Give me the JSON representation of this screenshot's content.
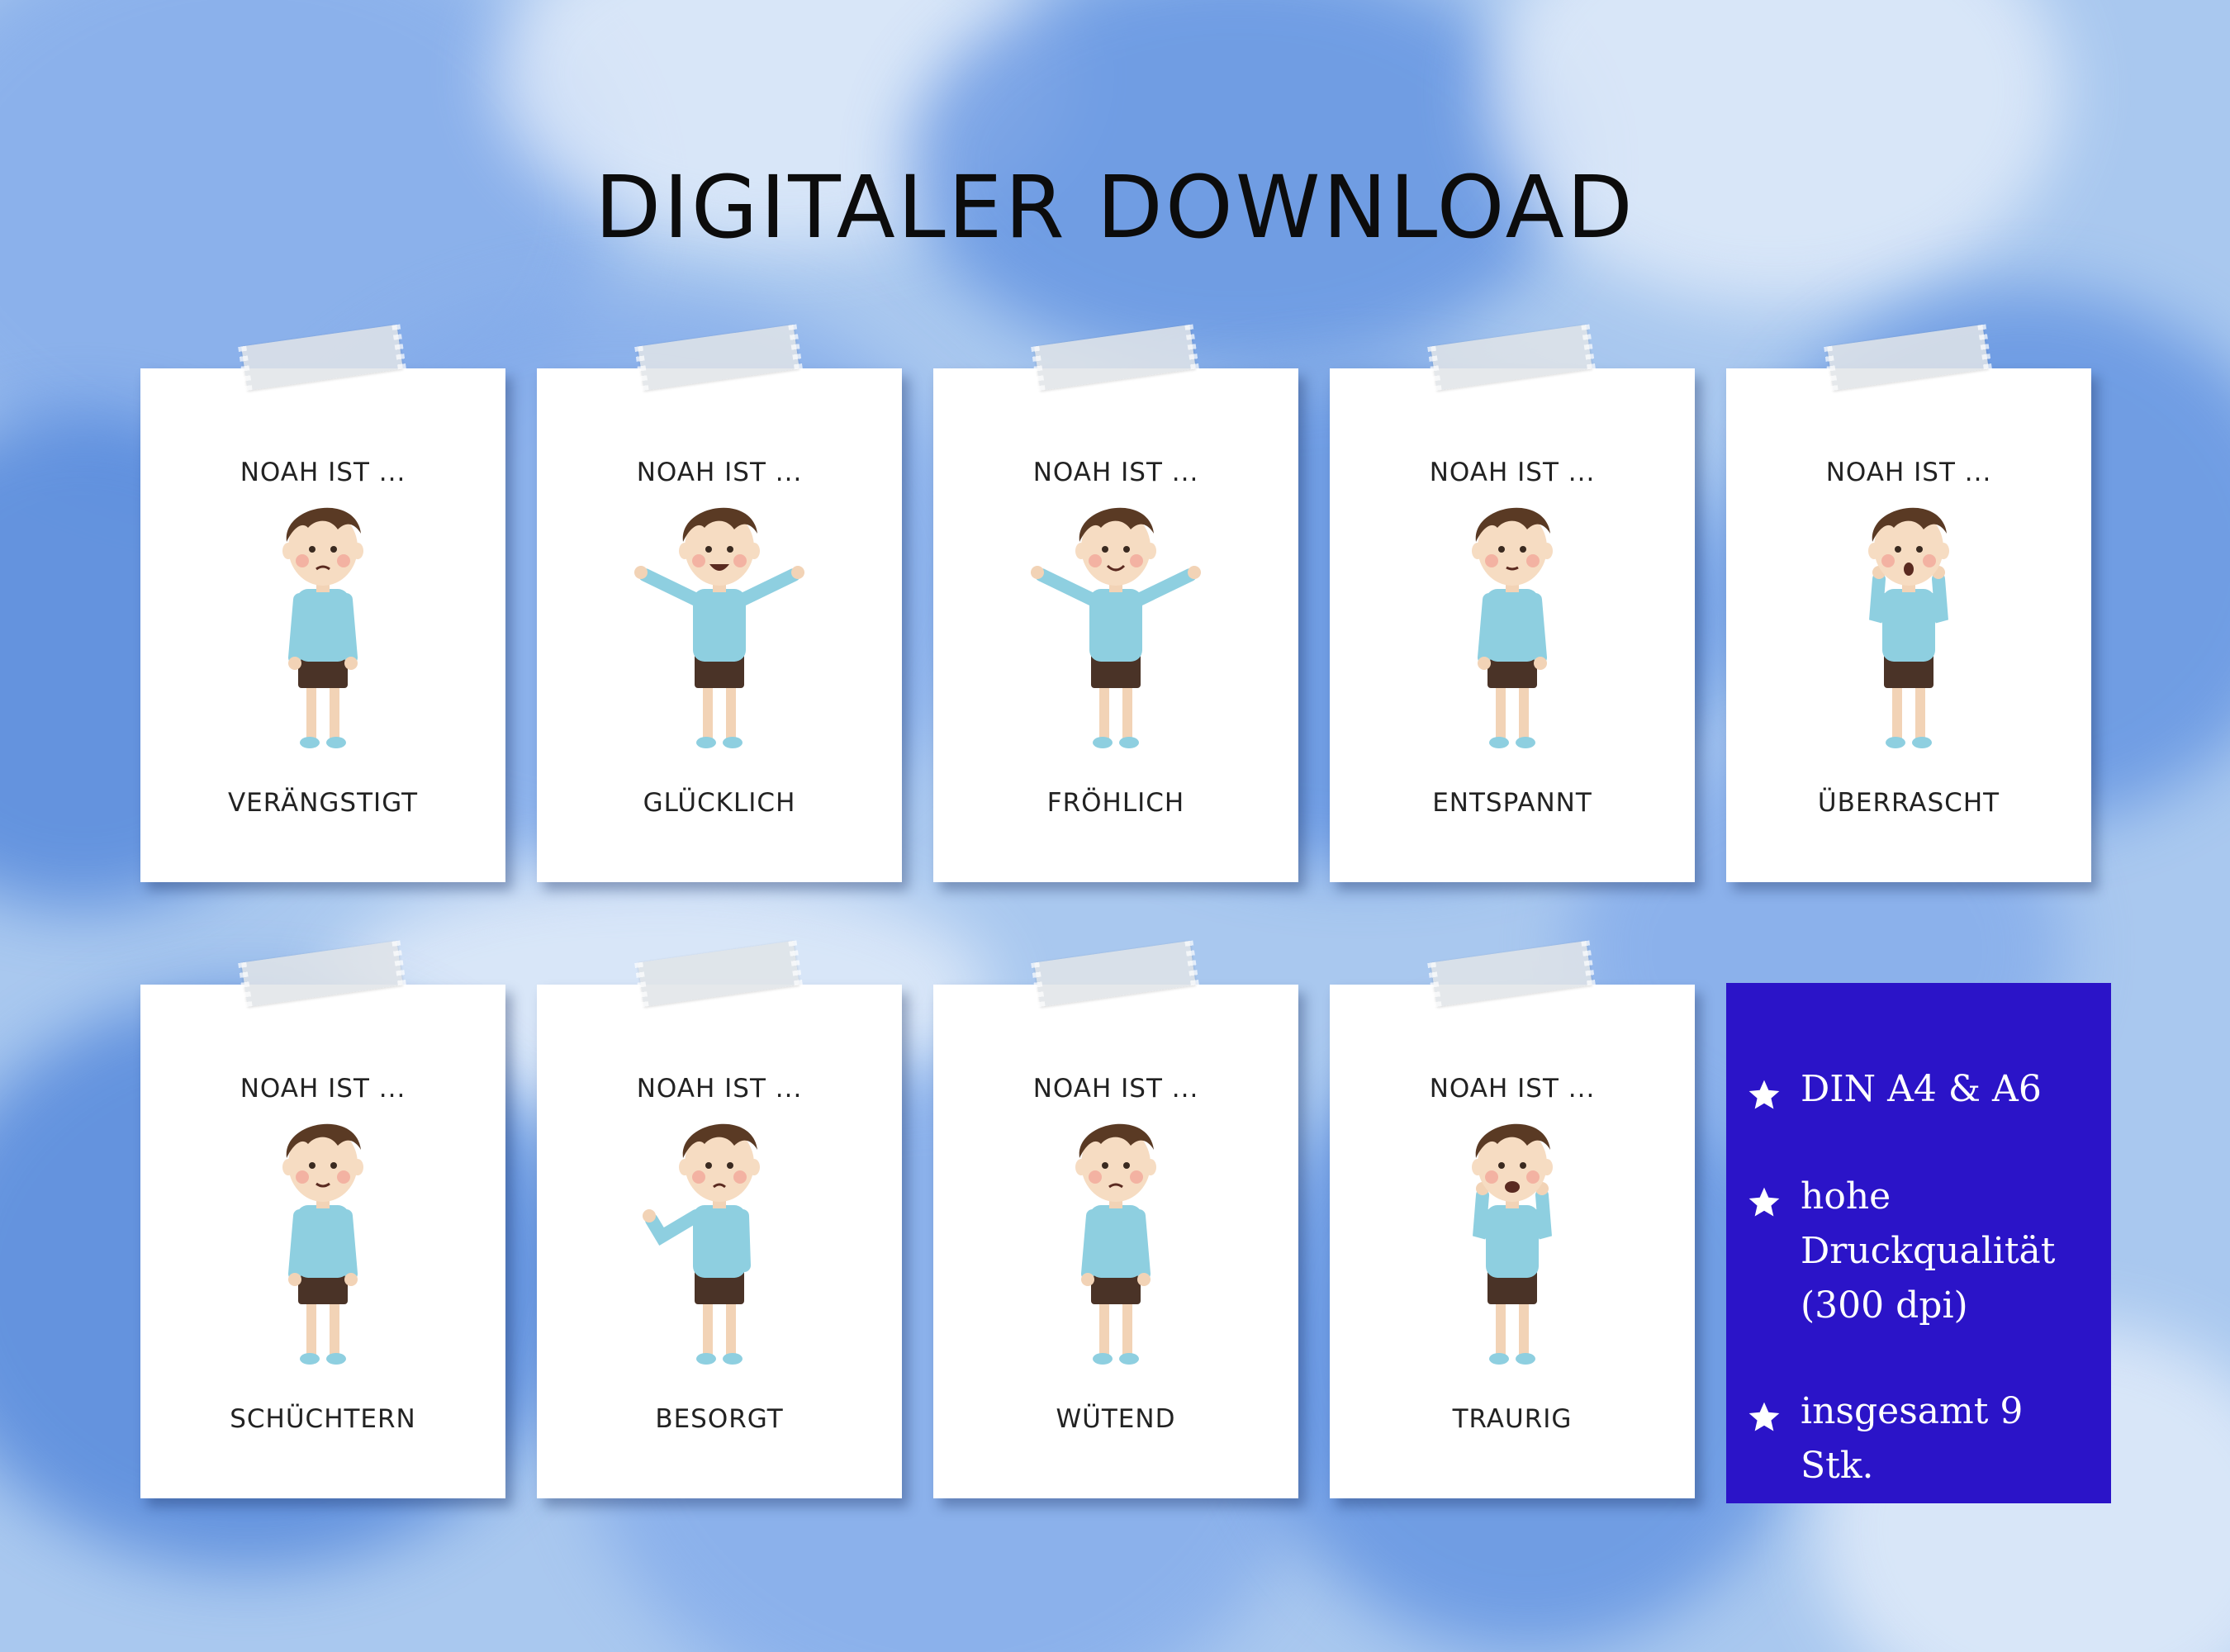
{
  "title": "DIGITALER DOWNLOAD",
  "cards": [
    {
      "top": "NOAH IST ...",
      "label": "VERÄNGSTIGT"
    },
    {
      "top": "NOAH IST ...",
      "label": "GLÜCKLICH"
    },
    {
      "top": "NOAH IST ...",
      "label": "FRÖHLICH"
    },
    {
      "top": "NOAH IST ...",
      "label": "ENTSPANNT"
    },
    {
      "top": "NOAH IST ...",
      "label": "ÜBERRASCHT"
    },
    {
      "top": "NOAH IST ...",
      "label": "SCHÜCHTERN"
    },
    {
      "top": "NOAH IST ...",
      "label": "BESORGT"
    },
    {
      "top": "NOAH IST ...",
      "label": "WÜTEND"
    },
    {
      "top": "NOAH IST ...",
      "label": "TRAURIG"
    }
  ],
  "info": {
    "items": [
      {
        "icon": "star-icon",
        "text": "DIN A4 & A6"
      },
      {
        "icon": "star-icon",
        "text": "hohe Druckqualität (300 dpi)"
      },
      {
        "icon": "star-icon",
        "text": "insgesamt 9 Stk."
      }
    ]
  },
  "colors": {
    "info_bg": "#2b14c8",
    "shirt": "#8ecfe0",
    "shorts": "#4a3327",
    "hair": "#5a3a24"
  }
}
